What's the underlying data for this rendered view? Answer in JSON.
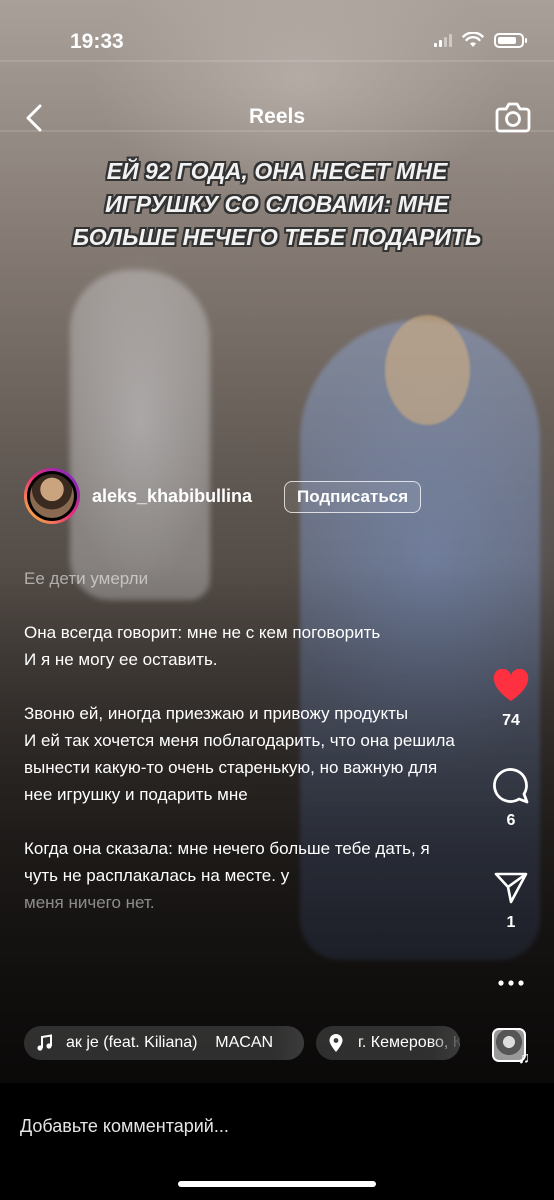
{
  "status_bar": {
    "time": "19:33",
    "battery_fill_fraction": 0.8
  },
  "header": {
    "title": "Reels",
    "back_icon": "chevron-left-icon",
    "camera_icon": "camera-icon"
  },
  "overlay_text": "ЕЙ 92 ГОДА, ОНА НЕСЕТ МНЕ ИГРУШКУ СО СЛОВАМИ: МНЕ БОЛЬШЕ НЕЧЕГО ТЕБЕ ПОДАРИТЬ",
  "author": {
    "username": "aleks_khabibullina",
    "follow_label": "Подписаться"
  },
  "caption": {
    "lines": [
      "Ее дети умерли",
      "",
      "Она всегда говорит: мне не с кем поговорить",
      "И я не могу ее оставить.",
      "",
      "Звоню ей, иногда приезжаю и привожу продукты",
      "И ей так хочется меня поблагодарить, что она решила вынести какую-то очень старенькую, но важную для нее игрушку и подарить мне",
      "",
      "Когда она сказала: мне нечего больше тебе дать, я чуть не расплакалась на месте. у",
      "меня ничего нет."
    ]
  },
  "actions": {
    "like": {
      "icon": "heart-icon",
      "count": "74",
      "color": "#ff3040"
    },
    "comment": {
      "icon": "comment-icon",
      "count": "6"
    },
    "share": {
      "icon": "send-icon",
      "count": "1"
    },
    "more": {
      "icon": "more-horizontal-icon"
    }
  },
  "audio": {
    "icon": "music-note-icon",
    "text": "ак je (feat. Kiliana)    MACAN"
  },
  "location": {
    "icon": "location-pin-icon",
    "text": "г. Кемерово, Ку"
  },
  "comment_bar": {
    "placeholder": "Добавьте комментарий..."
  }
}
